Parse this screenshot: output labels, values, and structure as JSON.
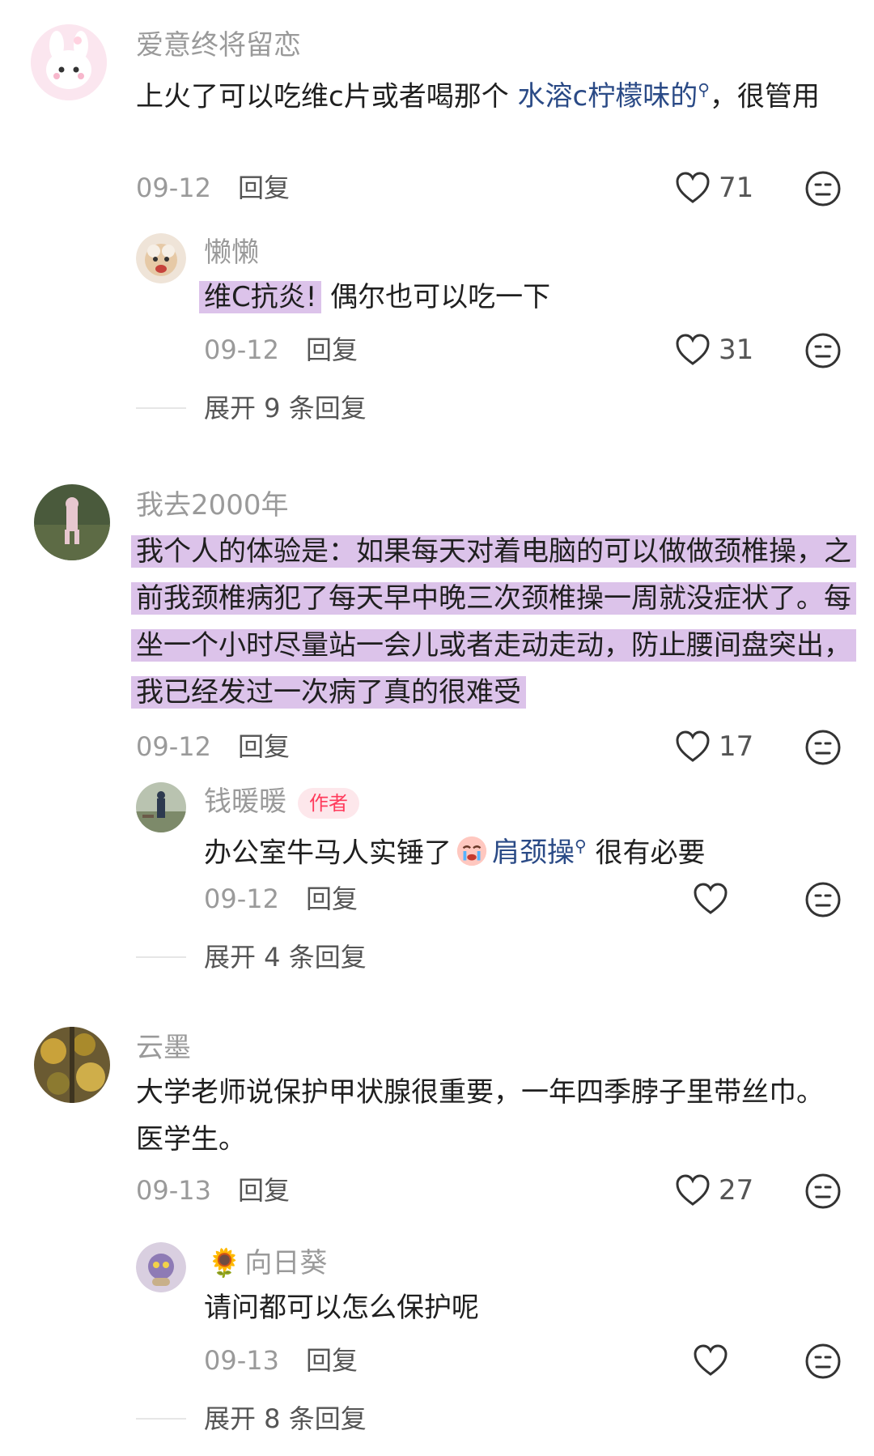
{
  "comments": [
    {
      "username": "爱意终将留恋",
      "text_before": "上火了可以吃维c片或者喝那个 ",
      "link_text": "水溶c柠檬味的",
      "text_after": "，很管用",
      "date": "09-12",
      "reply_label": "回复",
      "likes": "71",
      "reply": {
        "username": "懒懒",
        "highlight": "维C抗炎!",
        "text": " 偶尔也可以吃一下",
        "date": "09-12",
        "reply_label": "回复",
        "likes": "31"
      },
      "expand_label": "展开 9 条回复"
    },
    {
      "username": "我去2000年",
      "highlight_text": "我个人的体验是：如果每天对着电脑的可以做做颈椎操，之前我颈椎病犯了每天早中晚三次颈椎操一周就没症状了。每坐一个小时尽量站一会儿或者走动走动，防止腰间盘突出，我已经发过一次病了真的很难受",
      "date": "09-12",
      "reply_label": "回复",
      "likes": "17",
      "reply": {
        "username": "钱暖暖",
        "badge": "作者",
        "text_before": "办公室牛马人实锤了",
        "link_text": "肩颈操",
        "text_after": " 很有必要",
        "date": "09-12",
        "reply_label": "回复",
        "likes": ""
      },
      "expand_label": "展开 4 条回复"
    },
    {
      "username": "云墨",
      "text": "大学老师说保护甲状腺很重要，一年四季脖子里带丝巾。医学生。",
      "date": "09-13",
      "reply_label": "回复",
      "likes": "27",
      "reply": {
        "username": "向日葵",
        "name_prefix_emoji": "🌻",
        "text": "请问都可以怎么保护呢",
        "date": "09-13",
        "reply_label": "回复",
        "likes": ""
      },
      "expand_label": "展开 8 条回复"
    }
  ],
  "icons": {
    "like": "heart-outline-icon",
    "emoji": "neutral-face-icon",
    "search": "search-icon",
    "crying": "crying-face-icon"
  },
  "colors": {
    "highlight": "#dcc3ea",
    "link": "#2a4a86",
    "author_badge": "#ff3b5c",
    "muted": "#9a9a9a"
  }
}
